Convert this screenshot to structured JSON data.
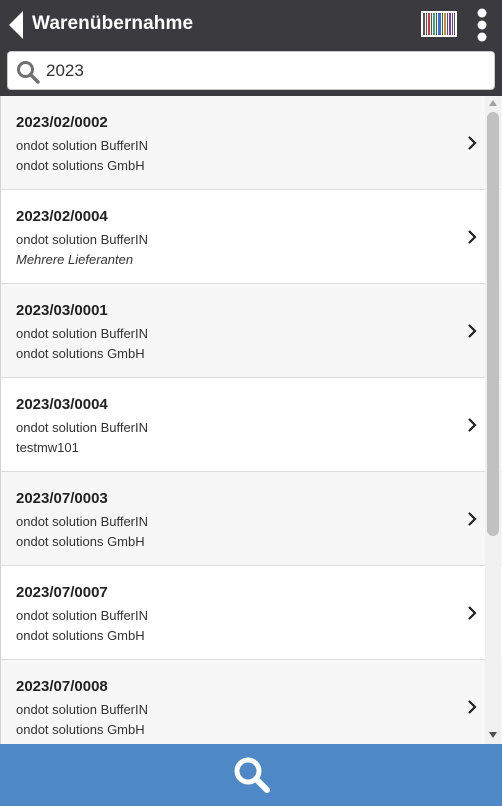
{
  "header": {
    "title": "Warenübernahme",
    "back_icon": "back-arrow-icon",
    "barcode_icon": "barcode-icon",
    "menu_icon": "more-vertical-icon",
    "background": "#3a3a3f"
  },
  "search": {
    "value": "2023",
    "icon": "search-icon"
  },
  "list": {
    "items": [
      {
        "id": "2023/02/0002",
        "line1": "ondot solution BufferIN",
        "line2": "ondot solutions GmbH",
        "italic": false
      },
      {
        "id": "2023/02/0004",
        "line1": "ondot solution BufferIN",
        "line2": "Mehrere Lieferanten",
        "italic": true
      },
      {
        "id": "2023/03/0001",
        "line1": "ondot solution BufferIN",
        "line2": "ondot solutions GmbH",
        "italic": false
      },
      {
        "id": "2023/03/0004",
        "line1": "ondot solution BufferIN",
        "line2": "testmw101",
        "italic": false
      },
      {
        "id": "2023/07/0003",
        "line1": "ondot solution BufferIN",
        "line2": "ondot solutions GmbH",
        "italic": false
      },
      {
        "id": "2023/07/0007",
        "line1": "ondot solution BufferIN",
        "line2": "ondot solutions GmbH",
        "italic": false
      },
      {
        "id": "2023/07/0008",
        "line1": "ondot solution BufferIN",
        "line2": "ondot solutions GmbH",
        "italic": false
      }
    ]
  },
  "footer": {
    "icon": "search-icon",
    "background": "#4f88c6"
  }
}
